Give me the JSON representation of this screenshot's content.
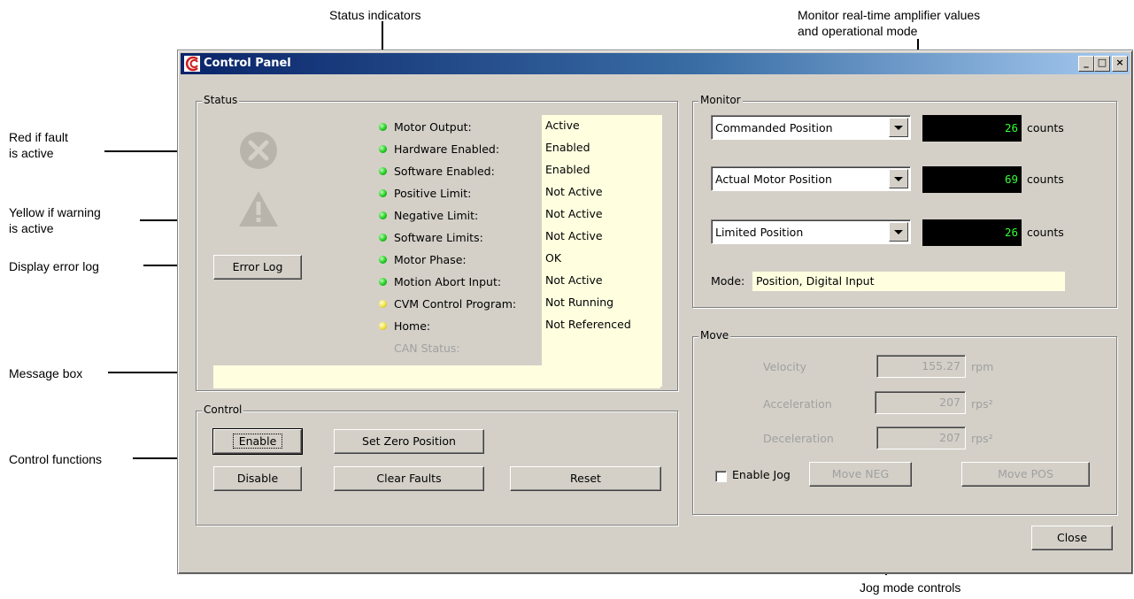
{
  "annotations": {
    "status_indicators": "Status indicators",
    "monitor_line1": "Monitor real-time amplifier values",
    "monitor_line2": "and operational mode",
    "red_fault_line1": "Red if fault",
    "red_fault_line2": "is active",
    "yellow_warning_line1": "Yellow if warning",
    "yellow_warning_line2": "is active",
    "display_error_log": "Display error log",
    "message_box": "Message box",
    "control_functions": "Control functions",
    "jog_mode_controls": "Jog mode controls"
  },
  "window": {
    "title": "Control Panel",
    "minimize_label": "_",
    "maximize_label": "□",
    "close_label": "×"
  },
  "status": {
    "group_label": "Status",
    "error_log_button": "Error Log",
    "items": [
      {
        "label": "Motor Output:",
        "value": "Active",
        "led": "green"
      },
      {
        "label": "Hardware Enabled:",
        "value": "Enabled",
        "led": "green"
      },
      {
        "label": "Software Enabled:",
        "value": "Enabled",
        "led": "green"
      },
      {
        "label": "Positive Limit:",
        "value": "Not Active",
        "led": "green"
      },
      {
        "label": "Negative Limit:",
        "value": "Not Active",
        "led": "green"
      },
      {
        "label": "Software Limits:",
        "value": "Not Active",
        "led": "green"
      },
      {
        "label": "Motor Phase:",
        "value": "OK",
        "led": "green"
      },
      {
        "label": "Motion Abort Input:",
        "value": "Not Active",
        "led": "green"
      },
      {
        "label": "CVM Control Program:",
        "value": "Not Running",
        "led": "yellow"
      },
      {
        "label": "Home:",
        "value": "Not Referenced",
        "led": "yellow"
      },
      {
        "label": "CAN Status:",
        "value": "",
        "led": "none"
      }
    ],
    "message": ""
  },
  "control": {
    "group_label": "Control",
    "enable": "Enable",
    "disable": "Disable",
    "set_zero_position": "Set Zero Position",
    "clear_faults": "Clear Faults",
    "reset": "Reset"
  },
  "monitor": {
    "group_label": "Monitor",
    "rows": [
      {
        "selection": "Commanded Position",
        "value": "26",
        "unit": "counts"
      },
      {
        "selection": "Actual Motor Position",
        "value": "69",
        "unit": "counts"
      },
      {
        "selection": "Limited Position",
        "value": "26",
        "unit": "counts"
      }
    ],
    "mode_label": "Mode:",
    "mode_value": "Position, Digital Input"
  },
  "move": {
    "group_label": "Move",
    "velocity_label": "Velocity",
    "velocity_value": "155.27",
    "velocity_unit": "rpm",
    "acceleration_label": "Acceleration",
    "acceleration_value": "207",
    "acceleration_unit": "rps²",
    "deceleration_label": "Deceleration",
    "deceleration_value": "207",
    "deceleration_unit": "rps²",
    "enable_jog_label": "Enable Jog",
    "enable_jog_checked": false,
    "move_neg": "Move NEG",
    "move_pos": "Move POS"
  },
  "close_button": "Close",
  "colors": {
    "window_bg": "#d4d0c8",
    "title_gradient_start": "#0a246a",
    "title_gradient_end": "#a6caf0",
    "value_bg": "#ffffe0",
    "lcd_bg": "#000000",
    "lcd_text": "#33ff33",
    "led_green": "#22cc22",
    "led_yellow": "#f0e040",
    "disabled_text": "#a0a0a0"
  }
}
